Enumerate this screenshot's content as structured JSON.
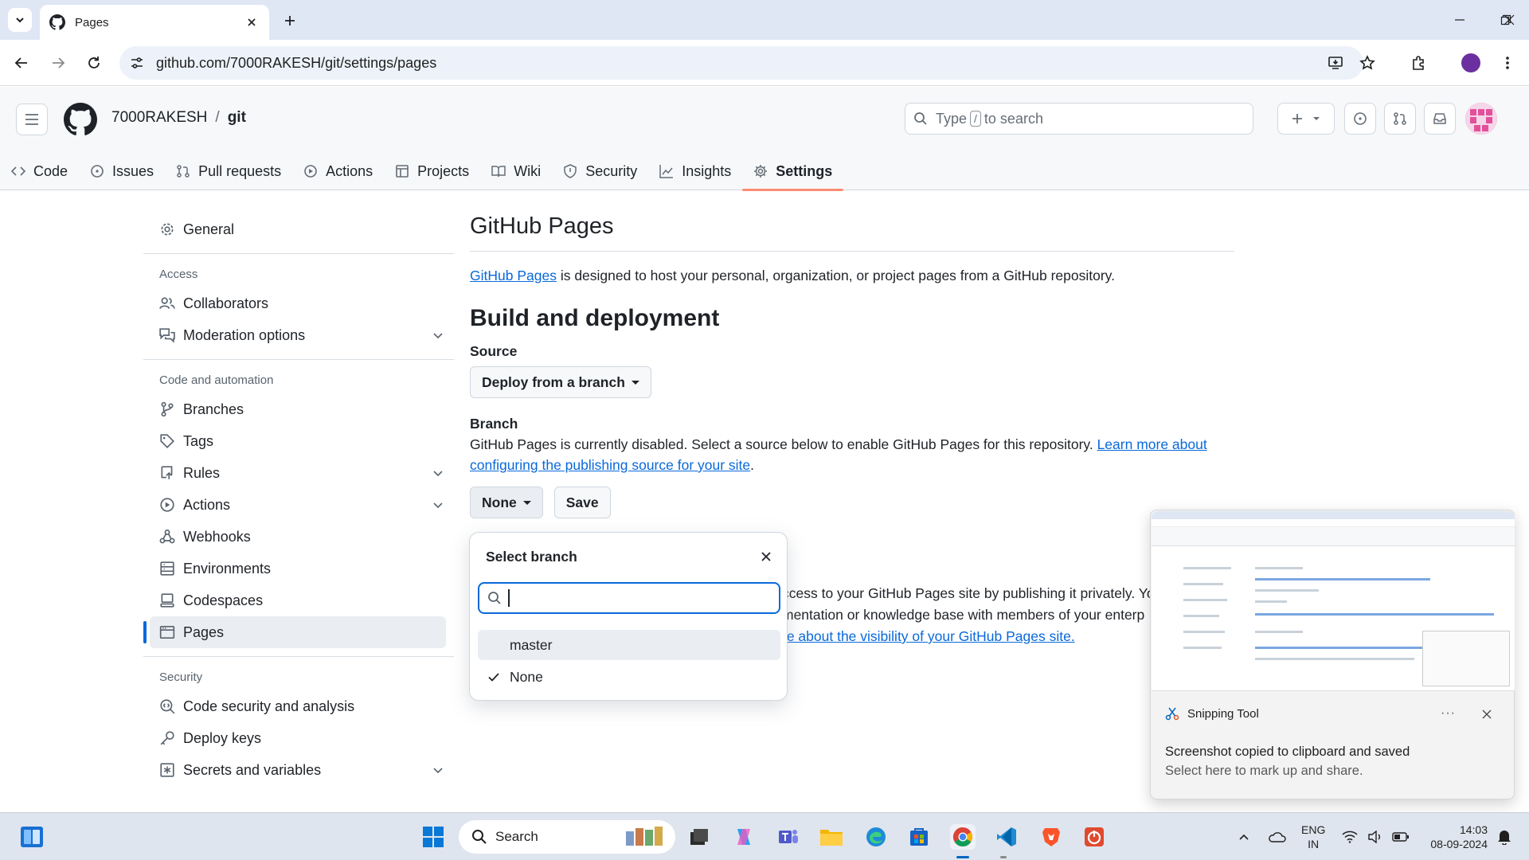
{
  "browser": {
    "tab_title": "Pages",
    "url": "github.com/7000RAKESH/git/settings/pages"
  },
  "header": {
    "owner": "7000RAKESH",
    "separator": "/",
    "repo": "git",
    "search_placeholder_pre": "Type",
    "search_key": "/",
    "search_placeholder_post": "to search"
  },
  "repo_nav": [
    {
      "label": "Code",
      "icon": "code-icon"
    },
    {
      "label": "Issues",
      "icon": "issue-icon"
    },
    {
      "label": "Pull requests",
      "icon": "pull-request-icon"
    },
    {
      "label": "Actions",
      "icon": "play-icon"
    },
    {
      "label": "Projects",
      "icon": "table-icon"
    },
    {
      "label": "Wiki",
      "icon": "book-icon"
    },
    {
      "label": "Security",
      "icon": "shield-icon"
    },
    {
      "label": "Insights",
      "icon": "graph-icon"
    },
    {
      "label": "Settings",
      "icon": "gear-icon",
      "active": true
    }
  ],
  "sidebar": {
    "general": "General",
    "access_heading": "Access",
    "collaborators": "Collaborators",
    "moderation": "Moderation options",
    "code_heading": "Code and automation",
    "branches": "Branches",
    "tags": "Tags",
    "rules": "Rules",
    "actions": "Actions",
    "webhooks": "Webhooks",
    "environments": "Environments",
    "codespaces": "Codespaces",
    "pages": "Pages",
    "security_heading": "Security",
    "code_security": "Code security and analysis",
    "deploy_keys": "Deploy keys",
    "secrets": "Secrets and variables"
  },
  "main": {
    "title": "GitHub Pages",
    "intro_link": "GitHub Pages",
    "intro_rest": " is designed to host your personal, organization, or project pages from a GitHub repository.",
    "build_title": "Build and deployment",
    "source_label": "Source",
    "source_value": "Deploy from a branch",
    "branch_label": "Branch",
    "branch_desc": "GitHub Pages is currently disabled. Select a source below to enable GitHub Pages for this repository. ",
    "branch_link": "Learn more about configuring the publishing source for your site",
    "branch_select": "None",
    "save": "Save",
    "vis_line1": "ccess to your GitHub Pages site by publishing it privately. Yo",
    "vis_line2": "mentation or knowledge base with members of your enterp",
    "vis_line3": "re about the visibility of your GitHub Pages site."
  },
  "popup": {
    "title": "Select branch",
    "options": [
      "master",
      "None"
    ],
    "selected": "None"
  },
  "toast": {
    "app": "Snipping Tool",
    "more": "···",
    "message": "Screenshot copied to clipboard and saved",
    "sub": "Select here to mark up and share."
  },
  "taskbar": {
    "search": "Search",
    "lang1": "ENG",
    "lang2": "IN",
    "time": "14:03",
    "date": "08-09-2024"
  },
  "colors": {
    "accent": "#0969da",
    "tab_underline": "#fd8c73"
  }
}
